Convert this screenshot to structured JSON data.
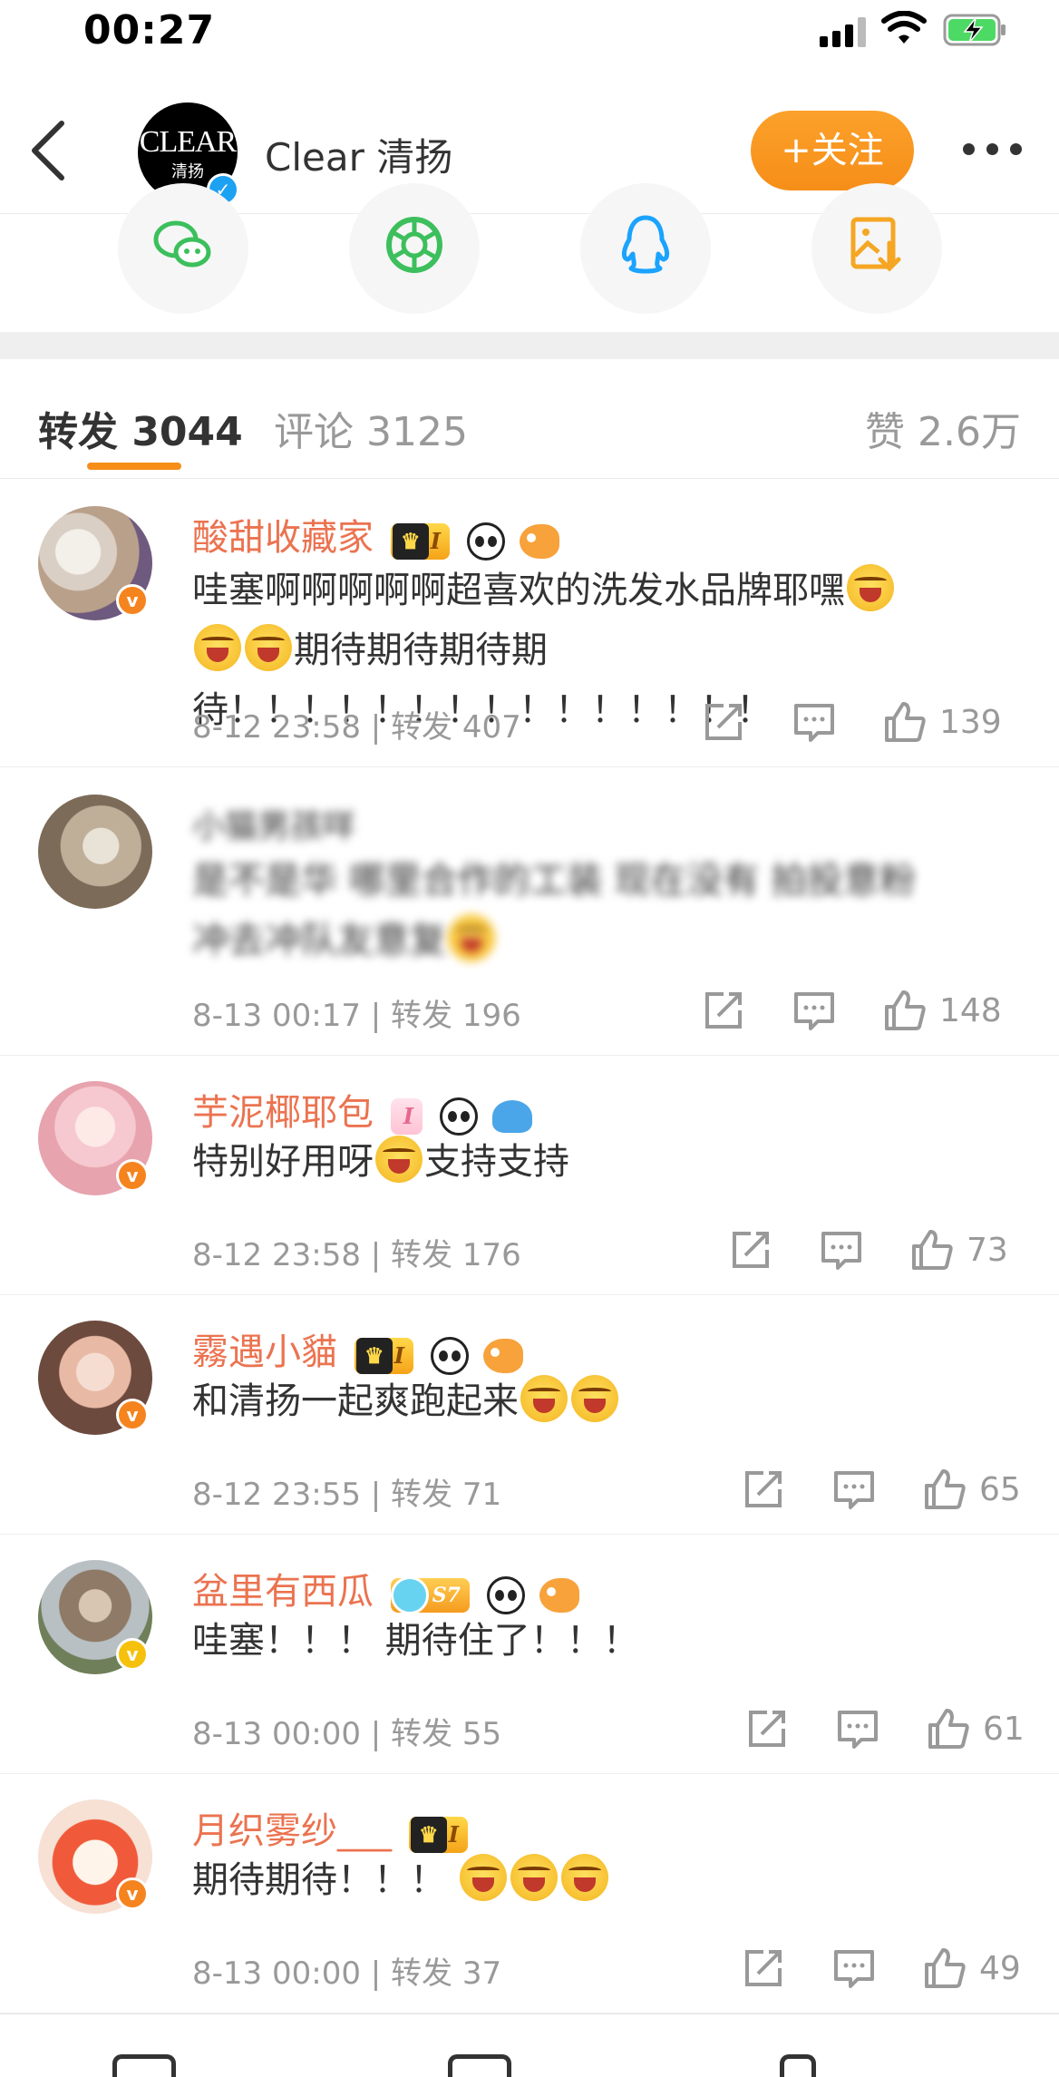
{
  "status_bar": {
    "time": "00:27"
  },
  "header": {
    "logo_text": "CLEAR",
    "logo_sub": "清扬",
    "title": "Clear 清扬",
    "follow_label": "+关注"
  },
  "share_icons": [
    "wechat-icon",
    "moments-icon",
    "qq-icon",
    "save-image-icon"
  ],
  "tabs": {
    "forward": "转发 3044",
    "comment": "评论 3125",
    "like": "赞 2.6万"
  },
  "colors": {
    "accent": "#f68e18",
    "nickname": "#eb7350",
    "muted": "#999999"
  },
  "items": [
    {
      "name": "酸甜收藏家",
      "level": "I",
      "text_1": "哇塞啊啊啊啊啊超喜欢的洗发水品牌耶嘿",
      "text_2": "期待期待期待期待！！！！！！！！！！！！！！！",
      "date": "8-12 23:58",
      "forward": "转发 407",
      "likes": "139"
    },
    {
      "name": "小猫男孩咩",
      "text_1": "是不是华 哪里合作的工装 现在没有 拍投意粉",
      "text_2": "冲去冲队友意复",
      "date": "8-13 00:17",
      "forward": "转发 196",
      "likes": "148"
    },
    {
      "name": "芋泥椰耶包",
      "level": "I",
      "text_1": "特别好用呀",
      "text_2": "支持支持",
      "date": "8-12 23:58",
      "forward": "转发 176",
      "likes": "73"
    },
    {
      "name": "霧遇小貓",
      "level": "I",
      "text_1": "和清扬一起爽跑起来",
      "date": "8-12 23:55",
      "forward": "转发 71",
      "likes": "65"
    },
    {
      "name": "盆里有西瓜",
      "level": "S7",
      "text_1": "哇塞！！！ 期待住了！！！",
      "date": "8-13 00:00",
      "forward": "转发 55",
      "likes": "61"
    },
    {
      "name": "月织雾纱___",
      "level": "I",
      "text_1": "期待期待！！！",
      "date": "8-13 00:00",
      "forward": "转发 37",
      "likes": "49"
    }
  ]
}
